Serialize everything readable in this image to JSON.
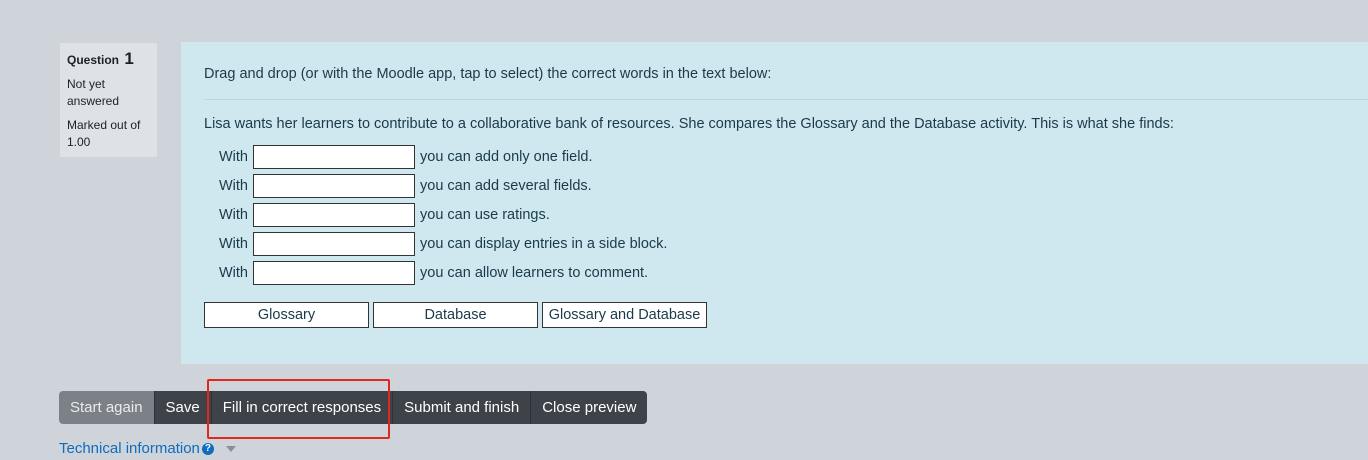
{
  "question_info": {
    "label": "Question",
    "number": "1",
    "state": "Not yet answered",
    "grade": "Marked out of 1.00"
  },
  "question": {
    "prompt": "Drag and drop (or with the Moodle app, tap to select) the correct words in the text below:",
    "intro": "Lisa wants her learners to contribute to a collaborative bank of resources. She compares the Glossary and the Database activity. This is what she finds:",
    "rows": [
      {
        "prefix": "With",
        "suffix": "you can add only one field."
      },
      {
        "prefix": "With",
        "suffix": "you can add several fields."
      },
      {
        "prefix": "With",
        "suffix": "you can use ratings."
      },
      {
        "prefix": "With",
        "suffix": "you can display entries in a side block."
      },
      {
        "prefix": "With",
        "suffix": "you can allow learners to comment."
      }
    ],
    "choices": [
      "Glossary",
      "Database",
      "Glossary and Database"
    ]
  },
  "buttons": {
    "start_again": "Start again",
    "save": "Save",
    "fill_correct": "Fill in correct responses",
    "submit_finish": "Submit and finish",
    "close_preview": "Close preview"
  },
  "tech_info": {
    "label": "Technical information",
    "help_icon": "question-circle-icon",
    "caret_icon": "caret-down-icon"
  },
  "colors": {
    "highlight": "#e0281c",
    "panel": "#cfe8ef",
    "button": "#3d4349",
    "link": "#0f6cbf"
  }
}
